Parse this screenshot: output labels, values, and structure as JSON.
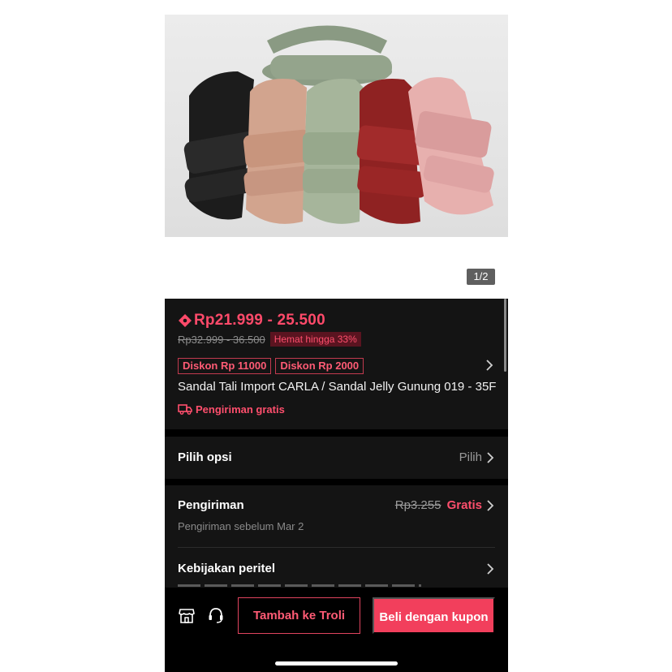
{
  "image": {
    "counter": "1/2"
  },
  "price": {
    "range": "Rp21.999 - 25.500",
    "original": "Rp32.999 - 36.500",
    "save_badge": "Hemat hingga 33%"
  },
  "coupons": [
    "Diskon Rp 11000",
    "Diskon Rp 2000"
  ],
  "product_title": "Sandal Tali Import CARLA / Sandal Jelly Gunung 019 - 35F",
  "free_shipping": "Pengiriman gratis",
  "options": {
    "label": "Pilih opsi",
    "value": "Pilih"
  },
  "shipping": {
    "label": "Pengiriman",
    "old_price": "Rp3.255",
    "price": "Gratis",
    "eta": "Pengiriman sebelum Mar 2"
  },
  "policy": {
    "label": "Kebijakan peritel"
  },
  "actions": {
    "add_to_cart": "Tambah ke Troli",
    "buy": "Beli dengan kupon"
  },
  "colors": {
    "accent": "#f23f5c",
    "panel": "#141414",
    "background": "#000000"
  },
  "icons": [
    "price-tag-icon",
    "chevron-right-icon",
    "truck-icon",
    "store-icon",
    "headset-icon"
  ]
}
